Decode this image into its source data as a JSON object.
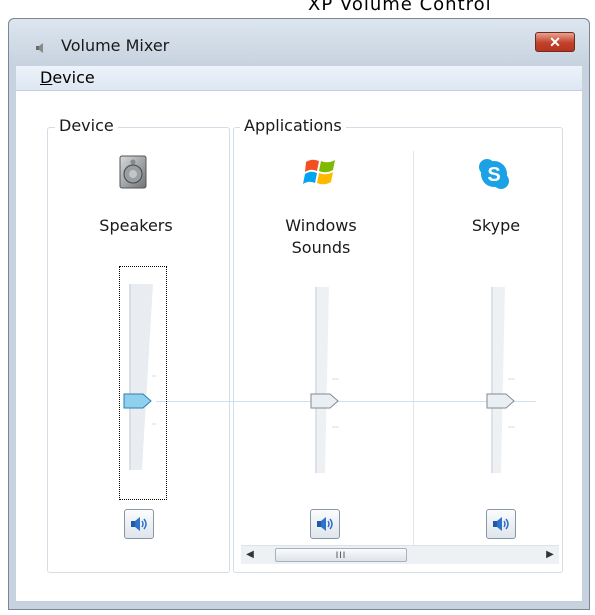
{
  "caption": "XP Volume Control",
  "window": {
    "title": "Volume Mixer",
    "close_label": "✕"
  },
  "menu": {
    "device_underlined": "D",
    "device_rest": "evice"
  },
  "groups": {
    "device_label": "Device",
    "applications_label": "Applications"
  },
  "channels": [
    {
      "name": "Speakers",
      "icon": "speaker-icon",
      "level": 0.4
    },
    {
      "name": "Windows\nSounds",
      "icon": "windows-logo-icon",
      "level": 0.4
    },
    {
      "name": "Skype",
      "icon": "skype-icon",
      "level": 0.4
    }
  ],
  "labels": {
    "speakers": "Speakers",
    "windows_line1": "Windows",
    "windows_line2": "Sounds",
    "skype": "Skype"
  },
  "scrollbar": {
    "grip": "III"
  }
}
